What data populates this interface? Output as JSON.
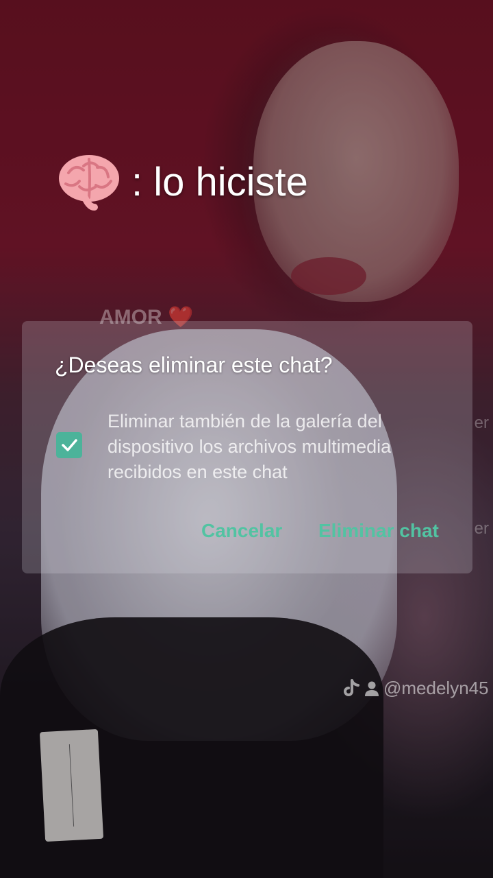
{
  "overlay": {
    "caption": ": lo hiciste",
    "emoji_icon": "brain-icon"
  },
  "background_chat": {
    "chat_name": "AMOR",
    "heart": "❤️",
    "side_fragment_1": "er",
    "side_fragment_2": "er"
  },
  "dialog": {
    "title": "¿Deseas eliminar este chat?",
    "checkbox_label": "Eliminar también de la galería del dispositivo los archivos multimedia recibidos en este chat",
    "checkbox_checked": true,
    "cancel_label": "Cancelar",
    "confirm_label": "Eliminar chat",
    "accent_color": "#52c3a2"
  },
  "watermark": {
    "icons": [
      "tiktok-icon",
      "user-icon"
    ],
    "handle": "@medelyn45"
  }
}
